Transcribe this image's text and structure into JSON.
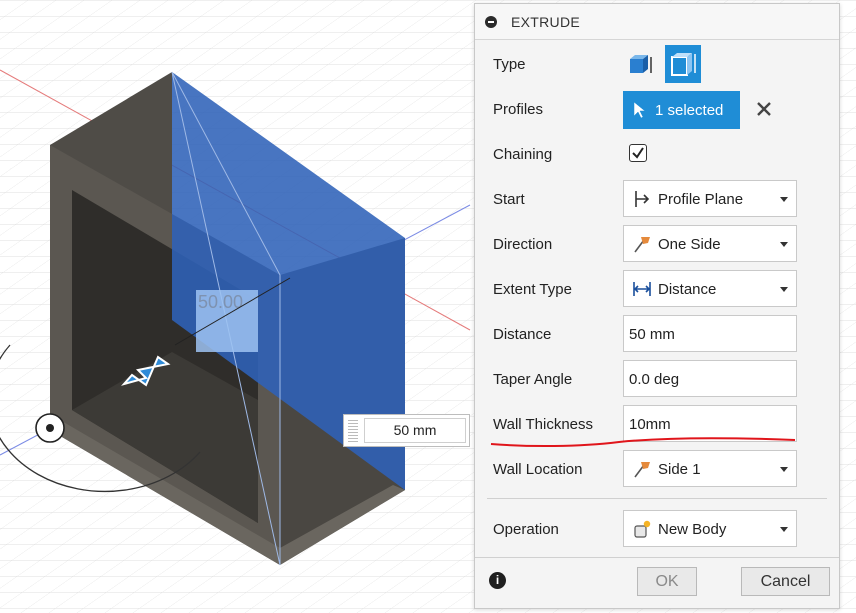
{
  "viewport": {
    "dimension_label": "50.00",
    "distance_value": "50 mm",
    "colors": {
      "selected_face": "#2f62b8",
      "body": "#56524c",
      "inner": "#3a3834",
      "arrow": "#2f8bd8"
    }
  },
  "panel": {
    "title": "EXTRUDE",
    "rows": {
      "type": {
        "label": "Type"
      },
      "profiles": {
        "label": "Profiles",
        "value": "1 selected"
      },
      "chaining": {
        "label": "Chaining",
        "checked": true
      },
      "start": {
        "label": "Start",
        "value": "Profile Plane",
        "icon": "profile-plane-icon"
      },
      "direction": {
        "label": "Direction",
        "value": "One Side",
        "icon": "one-side-icon"
      },
      "extent_type": {
        "label": "Extent Type",
        "value": "Distance",
        "icon": "distance-icon"
      },
      "distance": {
        "label": "Distance",
        "value": "50 mm"
      },
      "taper_angle": {
        "label": "Taper Angle",
        "value": "0.0 deg"
      },
      "wall_thickness": {
        "label": "Wall Thickness",
        "value": "10mm"
      },
      "wall_location": {
        "label": "Wall Location",
        "value": "Side 1",
        "icon": "side-flag-icon"
      },
      "operation": {
        "label": "Operation",
        "value": "New Body",
        "icon": "new-body-icon"
      }
    },
    "buttons": {
      "ok": "OK",
      "cancel": "Cancel"
    },
    "colors": {
      "accent": "#1f8dd6",
      "annotation": "#e0151b"
    }
  }
}
